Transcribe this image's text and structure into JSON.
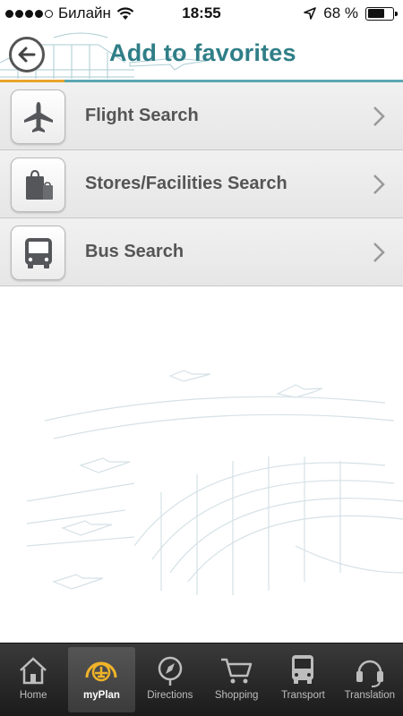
{
  "status_bar": {
    "carrier": "Билайн",
    "time": "18:55",
    "battery_percent": "68 %",
    "battery_level": 0.68,
    "signal_bars": 4
  },
  "header": {
    "title": "Add to favorites"
  },
  "menu": {
    "items": [
      {
        "label": "Flight Search",
        "icon": "airplane-icon"
      },
      {
        "label": "Stores/Facilities Search",
        "icon": "shopping-bag-icon"
      },
      {
        "label": "Bus Search",
        "icon": "bus-icon"
      }
    ]
  },
  "tabbar": {
    "tabs": [
      {
        "label": "Home",
        "icon": "house-icon"
      },
      {
        "label": "myPlan",
        "icon": "myplan-icon",
        "active": true
      },
      {
        "label": "Directions",
        "icon": "compass-icon"
      },
      {
        "label": "Shopping",
        "icon": "cart-icon"
      },
      {
        "label": "Transport",
        "icon": "bus-icon"
      },
      {
        "label": "Translation",
        "icon": "headset-icon"
      }
    ]
  },
  "colors": {
    "title": "#2f7e87",
    "accent_rule": "#5aa8b0",
    "accent_orange": "#e9a32b"
  }
}
